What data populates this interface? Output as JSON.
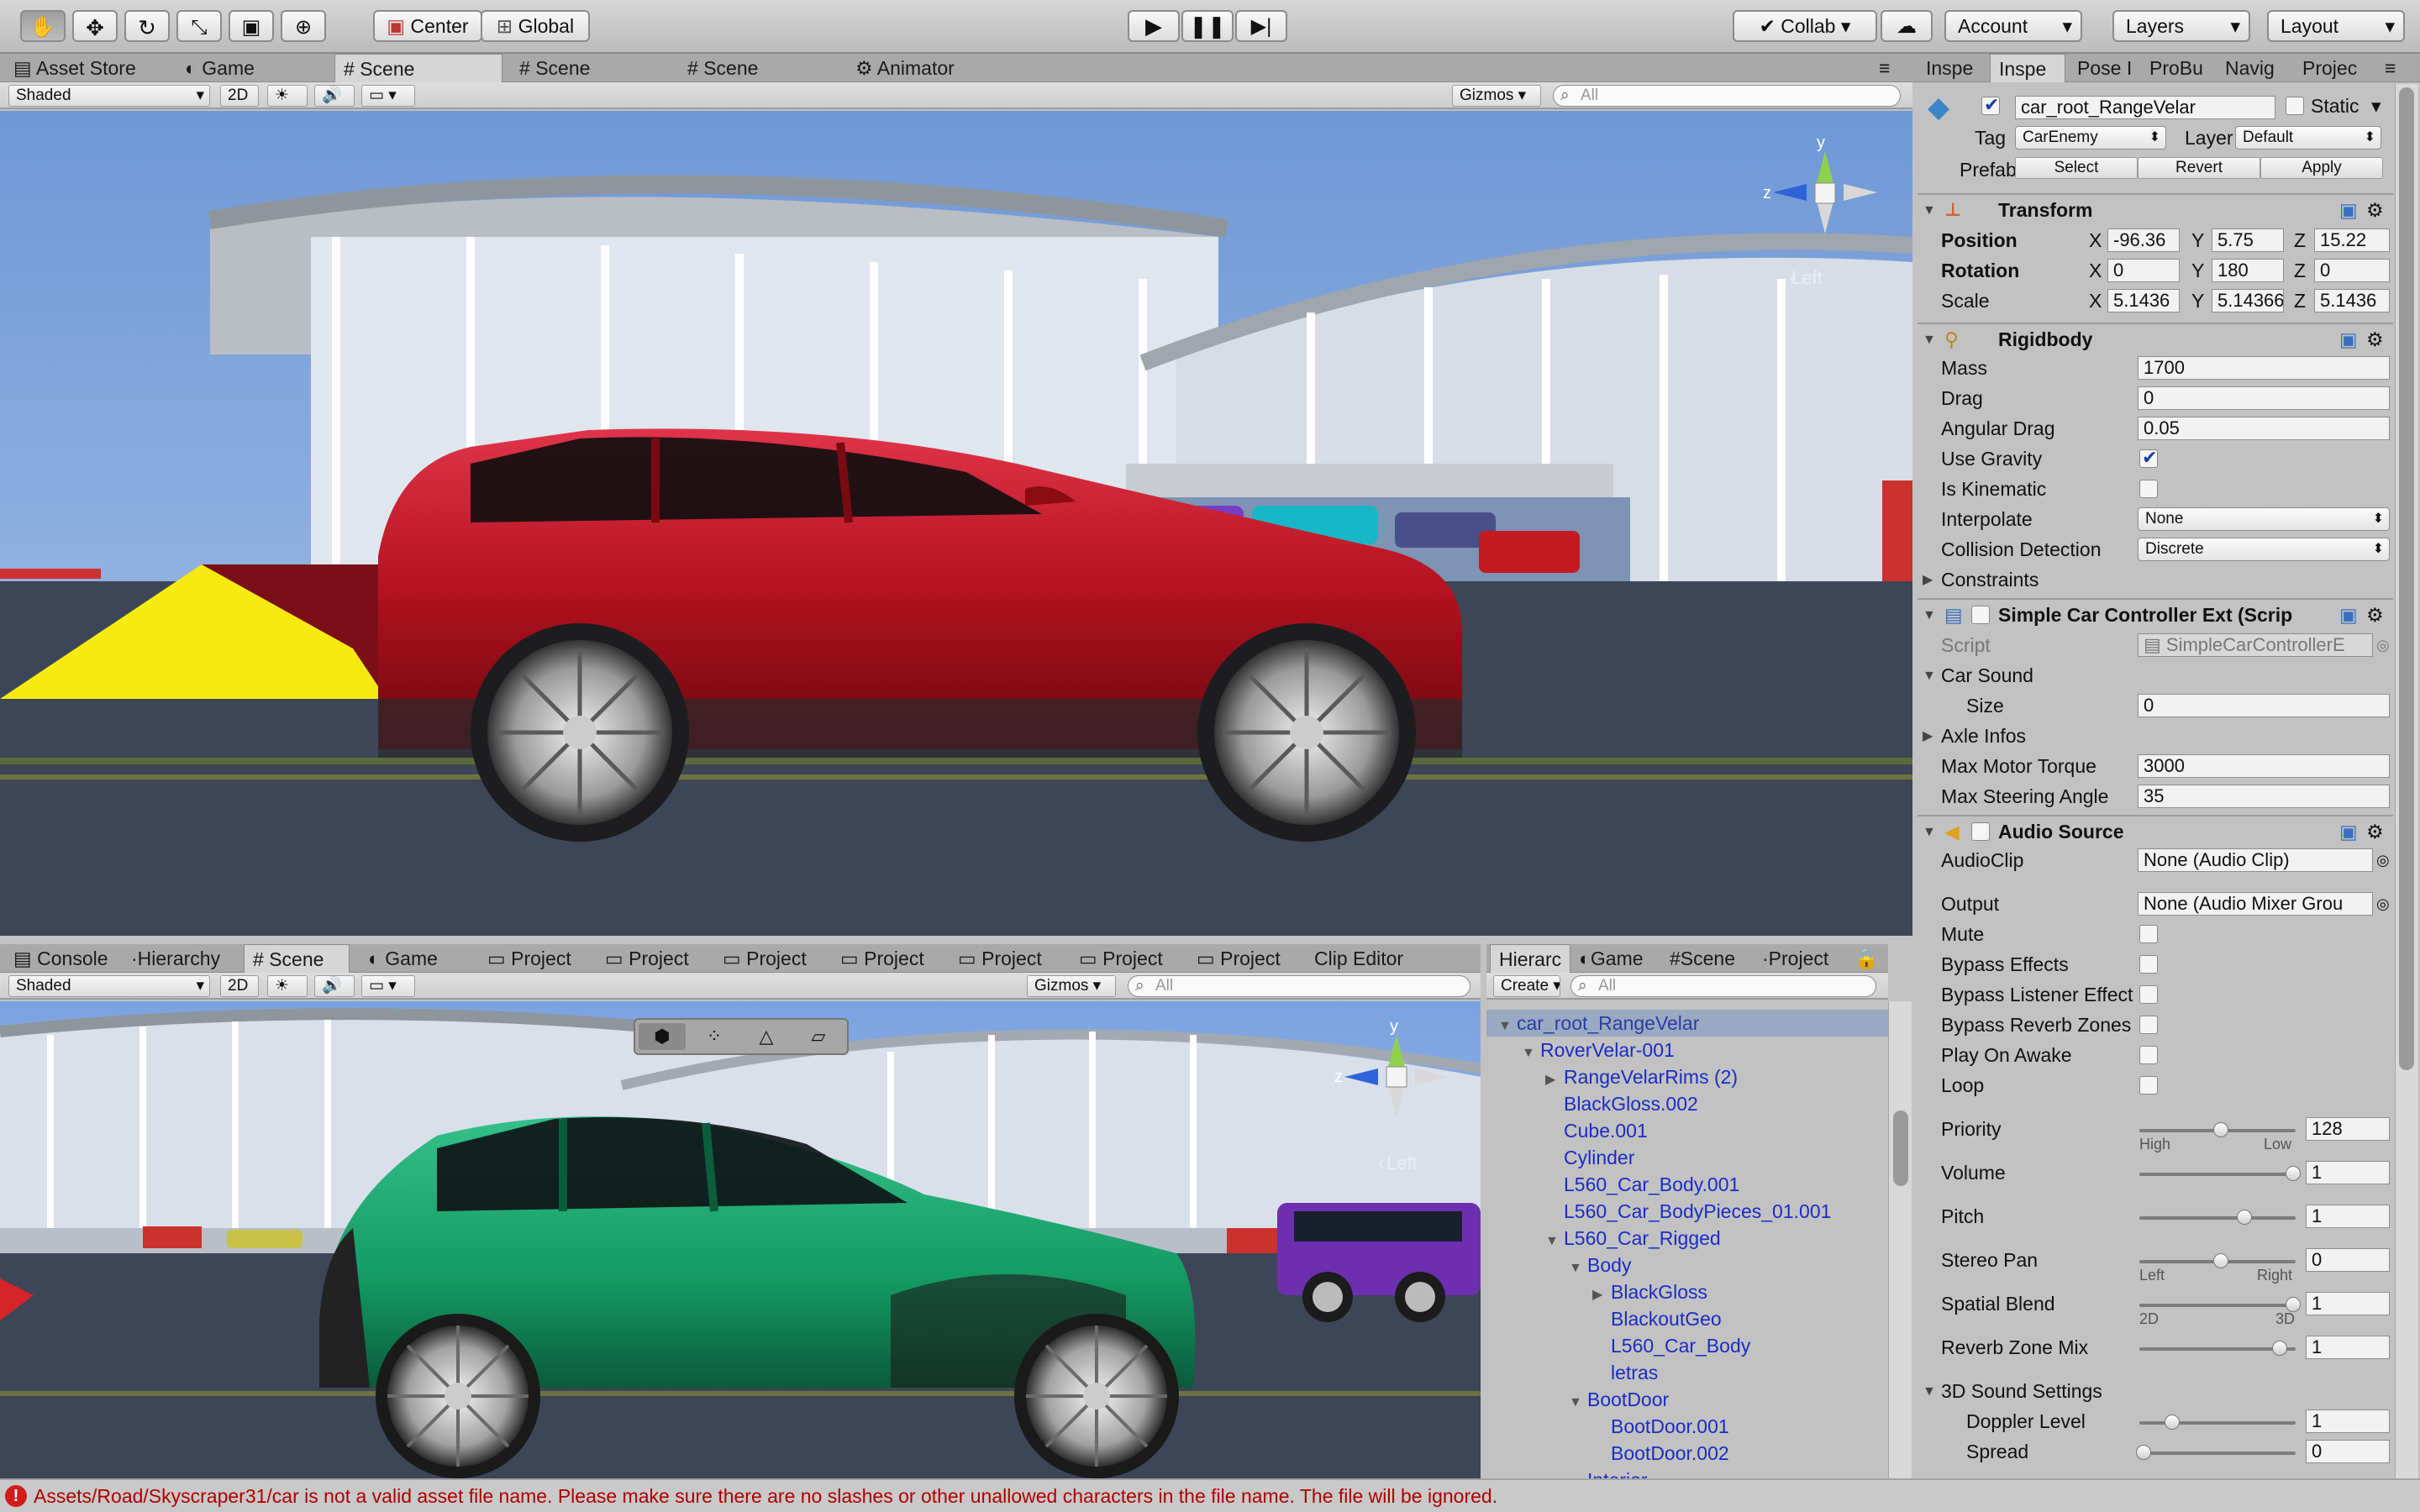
{
  "toolbar": {
    "center_label": "Center",
    "global_label": "Global",
    "collab_label": "Collab",
    "account_label": "Account",
    "layers_label": "Layers",
    "layout_label": "Layout"
  },
  "top_tabs": [
    "Asset Store",
    "Game",
    "Scene",
    "Scene",
    "Scene",
    "Animator"
  ],
  "top_scene_bar": {
    "shading": "Shaded",
    "mode_2d": "2D",
    "gizmos": "Gizmos",
    "search_placeholder": "All"
  },
  "top_gizmo_axes": {
    "y": "y",
    "z": "z",
    "view": "Left"
  },
  "inspector_tabs": [
    "Inspe",
    "Inspe",
    "Pose I",
    "ProBu",
    "Navig",
    "Projec"
  ],
  "inspector": {
    "object_name": "car_root_RangeVelar",
    "static_label": "Static",
    "tag_label": "Tag",
    "tag_value": "CarEnemy",
    "layer_label": "Layer",
    "layer_value": "Default",
    "prefab_label": "Prefab",
    "prefab_buttons": [
      "Select",
      "Revert",
      "Apply"
    ],
    "transform": {
      "title": "Transform",
      "position_label": "Position",
      "rotation_label": "Rotation",
      "scale_label": "Scale",
      "position": [
        "-96.36",
        "5.75",
        "15.22"
      ],
      "rotation": [
        "0",
        "180",
        "0"
      ],
      "scale": [
        "5.1436",
        "5.14366",
        "5.1436"
      ],
      "axes": [
        "X",
        "Y",
        "Z"
      ]
    },
    "rigidbody": {
      "title": "Rigidbody",
      "mass_label": "Mass",
      "mass": "1700",
      "drag_label": "Drag",
      "drag": "0",
      "angular_drag_label": "Angular Drag",
      "angular_drag": "0.05",
      "use_gravity_label": "Use Gravity",
      "is_kinematic_label": "Is Kinematic",
      "interpolate_label": "Interpolate",
      "interpolate": "None",
      "collision_label": "Collision Detection",
      "collision": "Discrete",
      "constraints_label": "Constraints"
    },
    "controller": {
      "title": "Simple Car Controller Ext (Scrip",
      "script_label": "Script",
      "script_value": "SimpleCarControllerE",
      "car_sound_label": "Car Sound",
      "size_label": "Size",
      "size": "0",
      "axle_label": "Axle Infos",
      "torque_label": "Max Motor Torque",
      "torque": "3000",
      "steer_label": "Max Steering Angle",
      "steer": "35"
    },
    "audio": {
      "title": "Audio Source",
      "clip_label": "AudioClip",
      "clip": "None (Audio Clip)",
      "output_label": "Output",
      "output": "None (Audio Mixer Grou",
      "mute_label": "Mute",
      "bypass_effects_label": "Bypass Effects",
      "bypass_listener_label": "Bypass Listener Effect",
      "bypass_reverb_label": "Bypass Reverb Zones",
      "play_on_awake_label": "Play On Awake",
      "loop_label": "Loop",
      "priority_label": "Priority",
      "priority": "128",
      "priority_low": "High",
      "priority_high": "Low",
      "volume_label": "Volume",
      "volume": "1",
      "pitch_label": "Pitch",
      "pitch": "1",
      "stereo_label": "Stereo Pan",
      "stereo": "0",
      "stereo_left": "Left",
      "stereo_right": "Right",
      "spatial_label": "Spatial Blend",
      "spatial": "1",
      "spatial_2d": "2D",
      "spatial_3d": "3D",
      "reverb_mix_label": "Reverb Zone Mix",
      "reverb_mix": "1",
      "sound3d_label": "3D Sound Settings",
      "doppler_label": "Doppler Level",
      "doppler": "1",
      "spread_label": "Spread",
      "spread": "0"
    }
  },
  "bottom_tabs": [
    "Console",
    "Hierarchy",
    "Scene",
    "Game",
    "Project",
    "Project",
    "Project",
    "Project",
    "Project",
    "Project",
    "Project",
    "Clip Editor"
  ],
  "bottom_scene_bar": {
    "shading": "Shaded",
    "mode_2d": "2D",
    "gizmos": "Gizmos",
    "search_placeholder": "All"
  },
  "bottom_gizmo_axes": {
    "y": "y",
    "z": "z",
    "view": "Left"
  },
  "hierarchy_tabs": [
    "Hierarc",
    "Game",
    "Scene",
    "Project"
  ],
  "hierarchy": {
    "create_label": "Create",
    "search_placeholder": "All",
    "items": [
      {
        "label": "car_root_RangeVelar",
        "depth": 0,
        "fold": "open"
      },
      {
        "label": "RoverVelar-001",
        "depth": 1,
        "fold": "open"
      },
      {
        "label": "RangeVelarRims (2)",
        "depth": 2,
        "fold": "closed"
      },
      {
        "label": "BlackGloss.002",
        "depth": 2,
        "fold": "none"
      },
      {
        "label": "Cube.001",
        "depth": 2,
        "fold": "none"
      },
      {
        "label": "Cylinder",
        "depth": 2,
        "fold": "none"
      },
      {
        "label": "L560_Car_Body.001",
        "depth": 2,
        "fold": "none"
      },
      {
        "label": "L560_Car_BodyPieces_01.001",
        "depth": 2,
        "fold": "none"
      },
      {
        "label": "L560_Car_Rigged",
        "depth": 2,
        "fold": "open"
      },
      {
        "label": "Body",
        "depth": 3,
        "fold": "open"
      },
      {
        "label": "BlackGloss",
        "depth": 4,
        "fold": "closed"
      },
      {
        "label": "BlackoutGeo",
        "depth": 4,
        "fold": "none"
      },
      {
        "label": "L560_Car_Body",
        "depth": 4,
        "fold": "none"
      },
      {
        "label": "letras",
        "depth": 4,
        "fold": "none"
      },
      {
        "label": "BootDoor",
        "depth": 3,
        "fold": "open"
      },
      {
        "label": "BootDoor.001",
        "depth": 4,
        "fold": "none"
      },
      {
        "label": "BootDoor.002",
        "depth": 4,
        "fold": "none"
      },
      {
        "label": "Interior",
        "depth": 3,
        "fold": "closed"
      }
    ]
  },
  "status_message": "Assets/Road/Skyscraper31/car  is not a valid asset file name. Please make sure there are no slashes or other unallowed characters in the file name. The file will be ignored.",
  "colors": {
    "red_car": "#c41a2a",
    "green_car": "#1e9a6a",
    "sky": "#7ea6e0",
    "road": "#3d4656"
  }
}
